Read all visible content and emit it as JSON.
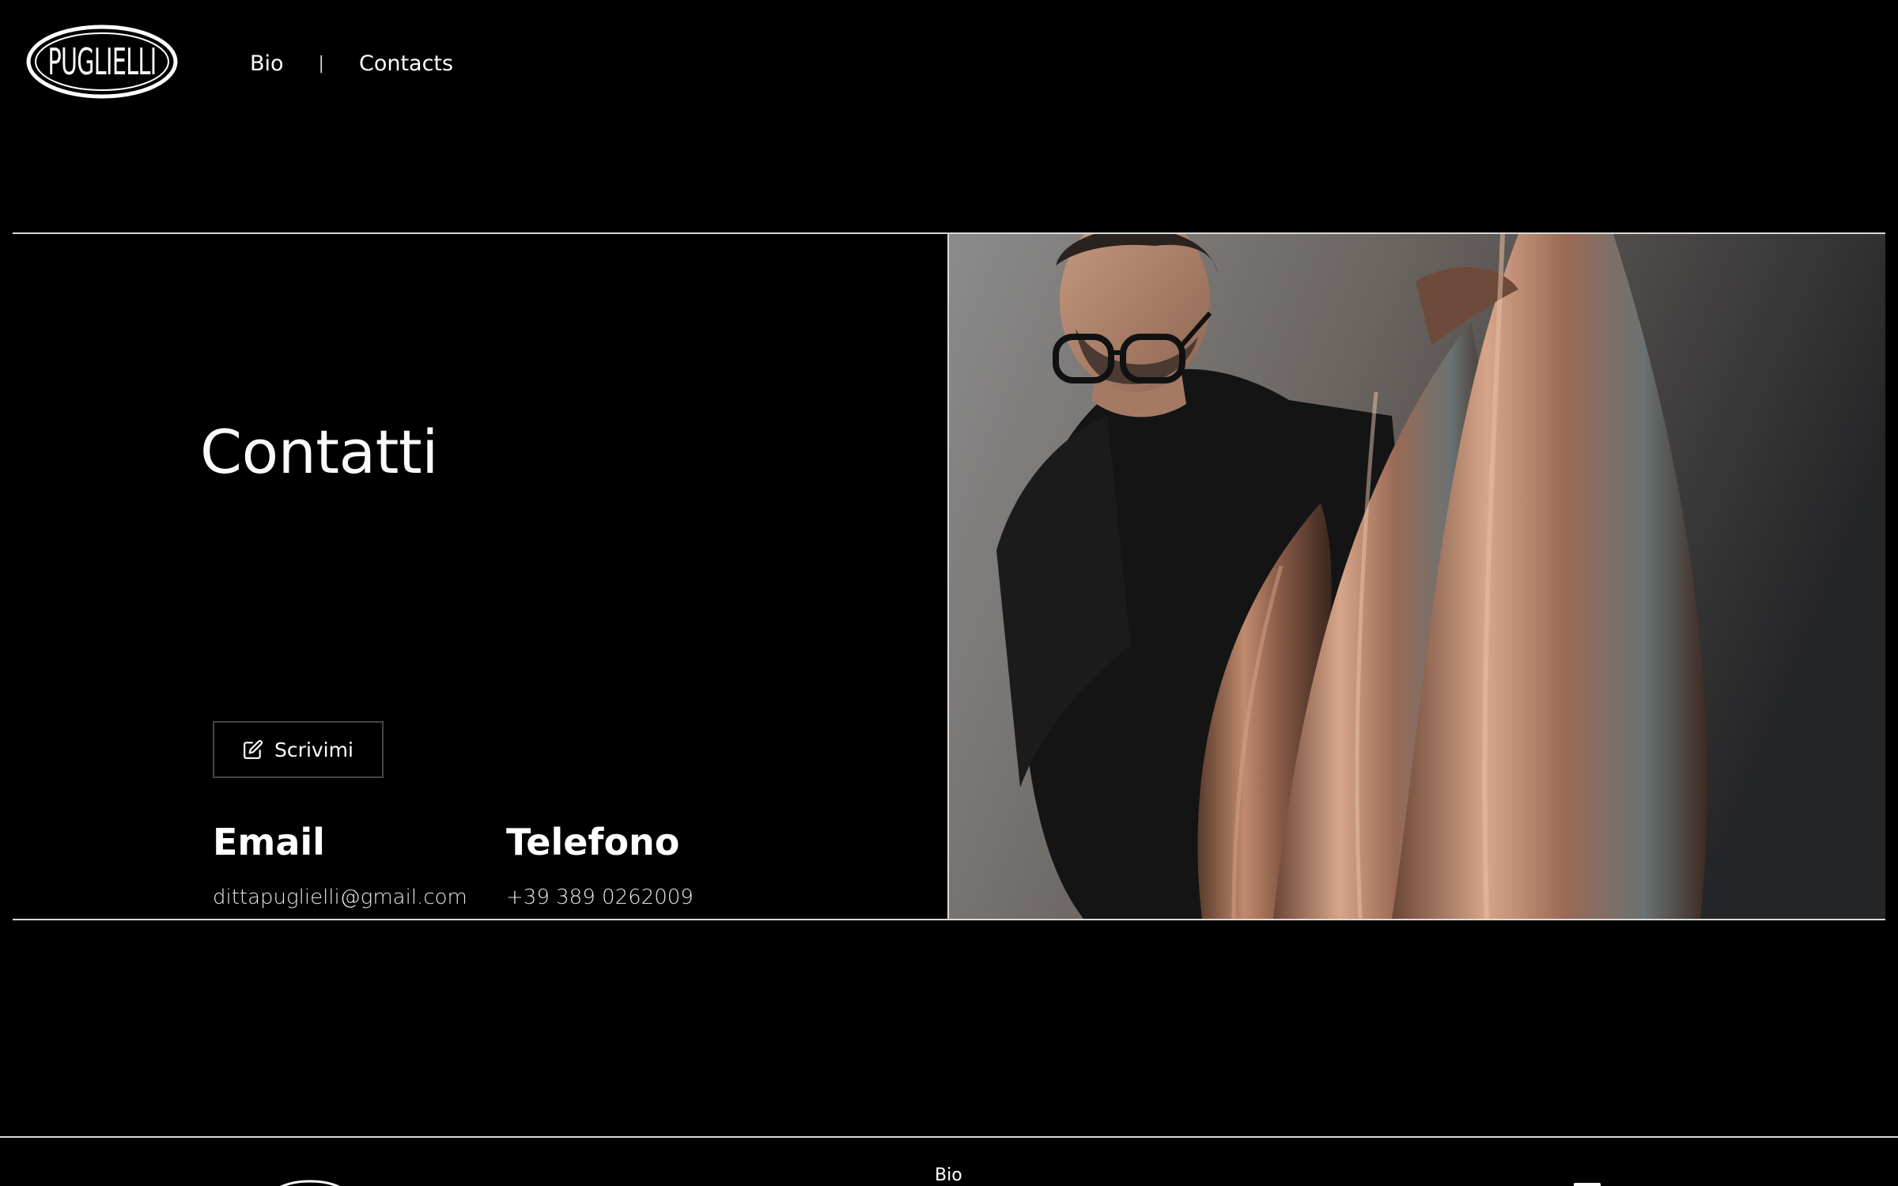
{
  "brand": {
    "logo_text": "PUGLIELLI"
  },
  "nav": {
    "bio_label": "Bio",
    "separator": "|",
    "contacts_label": "Contacts"
  },
  "main": {
    "title": "Contatti",
    "write_button": {
      "label": "Scrivimi",
      "icon": "edit-icon"
    },
    "email": {
      "heading": "Email",
      "value": "dittapuglielli@gmail.com"
    },
    "phone": {
      "heading": "Telefono",
      "value": "+39 389 0262009"
    },
    "photo": {
      "subject": "artist-with-copper-sculpture"
    }
  },
  "footer": {
    "bio_label": "Bio"
  },
  "colors": {
    "background": "#000000",
    "text": "#ffffff",
    "rule": "#d9d9d9",
    "button_border": "#444444",
    "copper": "#9a6a55"
  }
}
